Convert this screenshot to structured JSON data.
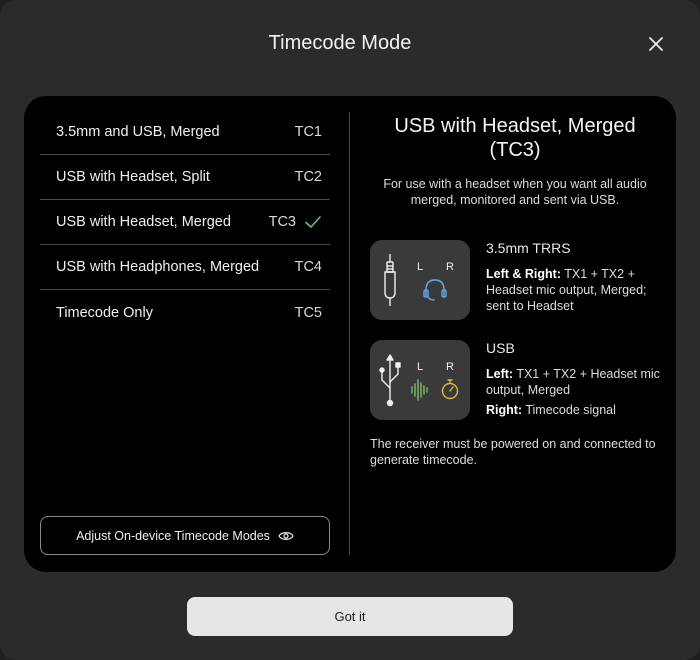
{
  "dialog": {
    "title": "Timecode Mode"
  },
  "modes": [
    {
      "label": "3.5mm and USB, Merged",
      "code": "TC1",
      "selected": false
    },
    {
      "label": "USB with Headset, Split",
      "code": "TC2",
      "selected": false
    },
    {
      "label": "USB with Headset, Merged",
      "code": "TC3",
      "selected": true
    },
    {
      "label": "USB with Headphones, Merged",
      "code": "TC4",
      "selected": false
    },
    {
      "label": "Timecode Only",
      "code": "TC5",
      "selected": false
    }
  ],
  "adjust_button": {
    "label": "Adjust On-device Timecode Modes"
  },
  "detail": {
    "title": "USB with Headset, Merged (TC3)",
    "description": "For use with a headset when you want all audio merged, monitored and sent via USB.",
    "outputs": [
      {
        "name": "3.5mm TRRS",
        "icon_left_label": "L",
        "icon_right_label": "R",
        "lines": [
          {
            "label": "Left & Right:",
            "text": " TX1 + TX2 + Headset mic output, Merged; sent to Headset"
          }
        ]
      },
      {
        "name": "USB",
        "icon_left_label": "L",
        "icon_right_label": "R",
        "lines": [
          {
            "label": "Left:",
            "text": " TX1 + TX2 + Headset mic output, Merged"
          },
          {
            "label": "Right:",
            "text": " Timecode signal"
          }
        ]
      }
    ],
    "footnote": "The receiver must be powered on and connected to generate timecode."
  },
  "footer": {
    "button_label": "Got it"
  },
  "colors": {
    "accent_check": "#6fbf73",
    "headset_icon": "#6aa6e6",
    "waveform_icon": "#7cbf6a",
    "timer_icon": "#e0b840"
  }
}
